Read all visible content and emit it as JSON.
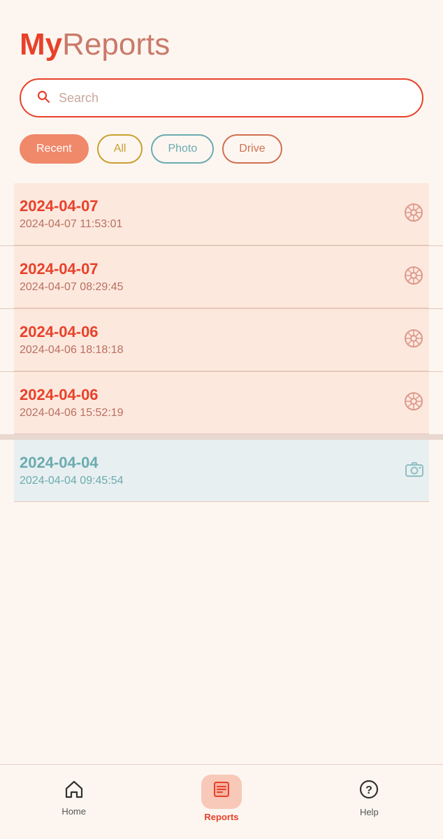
{
  "header": {
    "title_my": "My",
    "title_reports": "Reports"
  },
  "search": {
    "placeholder": "Search"
  },
  "filters": [
    {
      "id": "recent",
      "label": "Recent",
      "active": true
    },
    {
      "id": "all",
      "label": "All",
      "active": false
    },
    {
      "id": "photo",
      "label": "Photo",
      "active": false
    },
    {
      "id": "drive",
      "label": "Drive",
      "active": false
    }
  ],
  "reports": [
    {
      "id": 1,
      "date": "2024-04-07",
      "timestamp": "2024-04-07 11:53:01",
      "type": "wheel",
      "color": "salmon"
    },
    {
      "id": 2,
      "date": "2024-04-07",
      "timestamp": "2024-04-07 08:29:45",
      "type": "wheel",
      "color": "salmon"
    },
    {
      "id": 3,
      "date": "2024-04-06",
      "timestamp": "2024-04-06 18:18:18",
      "type": "wheel",
      "color": "salmon"
    },
    {
      "id": 4,
      "date": "2024-04-06",
      "timestamp": "2024-04-06 15:52:19",
      "type": "wheel",
      "color": "salmon"
    },
    {
      "id": 5,
      "date": "2024-04-04",
      "timestamp": "2024-04-04 09:45:54",
      "type": "camera",
      "color": "blue"
    }
  ],
  "nav": {
    "items": [
      {
        "id": "home",
        "label": "Home",
        "active": false
      },
      {
        "id": "reports",
        "label": "Reports",
        "active": true
      },
      {
        "id": "help",
        "label": "Help",
        "active": false
      }
    ]
  }
}
